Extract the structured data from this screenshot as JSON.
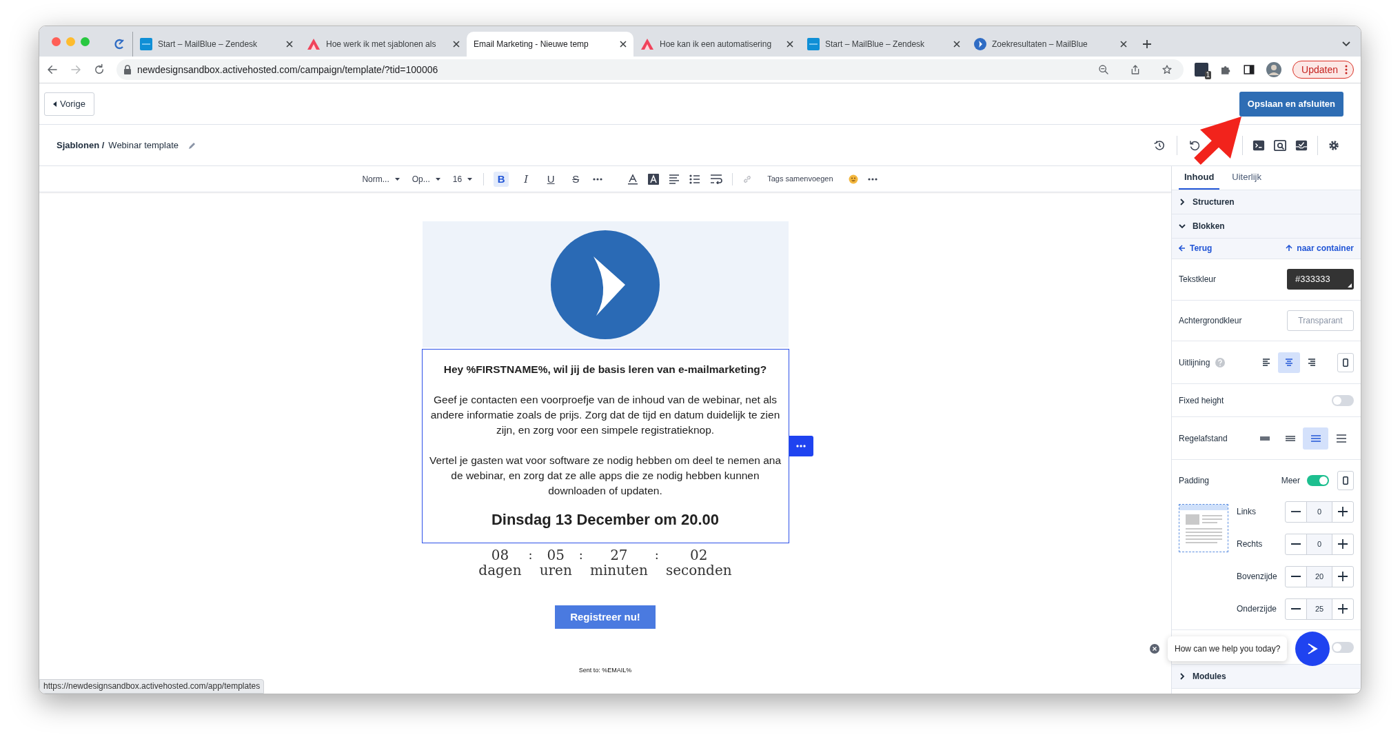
{
  "browser": {
    "tabs": [
      {
        "kind": "zendesk",
        "title": "Start – MailBlue – Zendesk",
        "selected": false
      },
      {
        "kind": "article",
        "title": "Hoe werk ik met sjablonen als",
        "selected": false
      },
      {
        "kind": "blank",
        "title": "Email Marketing - Nieuwe temp",
        "selected": true
      },
      {
        "kind": "article",
        "title": "Hoe kan ik een automatisering",
        "selected": false
      },
      {
        "kind": "zendesk",
        "title": "Start – MailBlue – Zendesk",
        "selected": false
      },
      {
        "kind": "mailblue",
        "title": "Zoekresultaten – MailBlue",
        "selected": false
      }
    ],
    "address": "newdesignsandbox.activehosted.com/campaign/template/?tid=100006",
    "extension_badge": "1",
    "update_button": "Updaten"
  },
  "header": {
    "back_button": "Vorige",
    "save_button": "Opslaan en afsluiten"
  },
  "breadcrumb": {
    "parent": "Sjablonen /",
    "current": "Webinar template"
  },
  "toolbar": {
    "dropdowns": [
      "Norm...",
      "Op...",
      "16"
    ],
    "format_buttons": [
      {
        "kind": "bold",
        "label": "B",
        "selected": true
      },
      {
        "kind": "italic",
        "label": "I",
        "selected": false
      },
      {
        "kind": "underline",
        "label": "U",
        "selected": false
      },
      {
        "kind": "strike",
        "label": "S",
        "selected": false
      }
    ],
    "tags_button": "Tags samenvoegen"
  },
  "email": {
    "heading": "Hey %FIRSTNAME%, wil jij de basis leren van e-mailmarketing?",
    "paragraphs": [
      "Geef je contacten een voorproefje van de inhoud van de webinar, net als andere informatie zoals de prijs. Zorg dat de tijd en datum duidelijk te zien zijn, en zorg voor een simpele registratieknop.",
      "Vertel je gasten wat voor software ze nodig hebben om deel te nemen ana de webinar, en zorg dat ze alle apps die ze nodig hebben kunnen downloaden of updaten."
    ],
    "date": "Dinsdag 13 December om 20.00",
    "countdown": [
      {
        "value": "08",
        "unit": "dagen"
      },
      {
        "value": "05",
        "unit": "uren"
      },
      {
        "value": "27",
        "unit": "minuten"
      },
      {
        "value": "02",
        "unit": "seconden"
      }
    ],
    "separator": ":",
    "button": "Registreer nu!",
    "footer": "Sent to: %EMAIL%"
  },
  "panel": {
    "tabs": [
      {
        "label": "Inhoud",
        "selected": true
      },
      {
        "label": "Uiterlijk",
        "selected": false
      }
    ],
    "sections": [
      {
        "label": "Structuren",
        "expanded": false
      },
      {
        "label": "Blokken",
        "expanded": true
      }
    ],
    "back_link": "Terug",
    "container_link": "naar container",
    "text_color": {
      "label": "Tekstkleur",
      "value": "#333333"
    },
    "background_color": {
      "label": "Achtergrondkleur",
      "placeholder": "Transparant"
    },
    "alignment": {
      "label": "Uitlijning",
      "options": [
        {
          "selected": false
        },
        {
          "selected": true
        },
        {
          "selected": false
        }
      ]
    },
    "fixed_height": {
      "label": "Fixed height",
      "on": false
    },
    "line_height": {
      "label": "Regelafstand",
      "options": [
        {
          "selected": false
        },
        {
          "selected": false
        },
        {
          "selected": true
        },
        {
          "selected": false
        }
      ]
    },
    "padding": {
      "label": "Padding",
      "more_label": "Meer",
      "more": true,
      "sides": [
        {
          "label": "Links",
          "value": "0"
        },
        {
          "label": "Rechts",
          "value": "0"
        },
        {
          "label": "Bovenzijde",
          "value": "20"
        },
        {
          "label": "Onderzijde",
          "value": "25"
        }
      ]
    },
    "hidden_toggle": {
      "on": false
    },
    "modules": {
      "label": "Modules",
      "expanded": false
    }
  },
  "chat": {
    "message": "How can we help you today?"
  },
  "status_url": "https://newdesignsandbox.activehosted.com/app/templates"
}
